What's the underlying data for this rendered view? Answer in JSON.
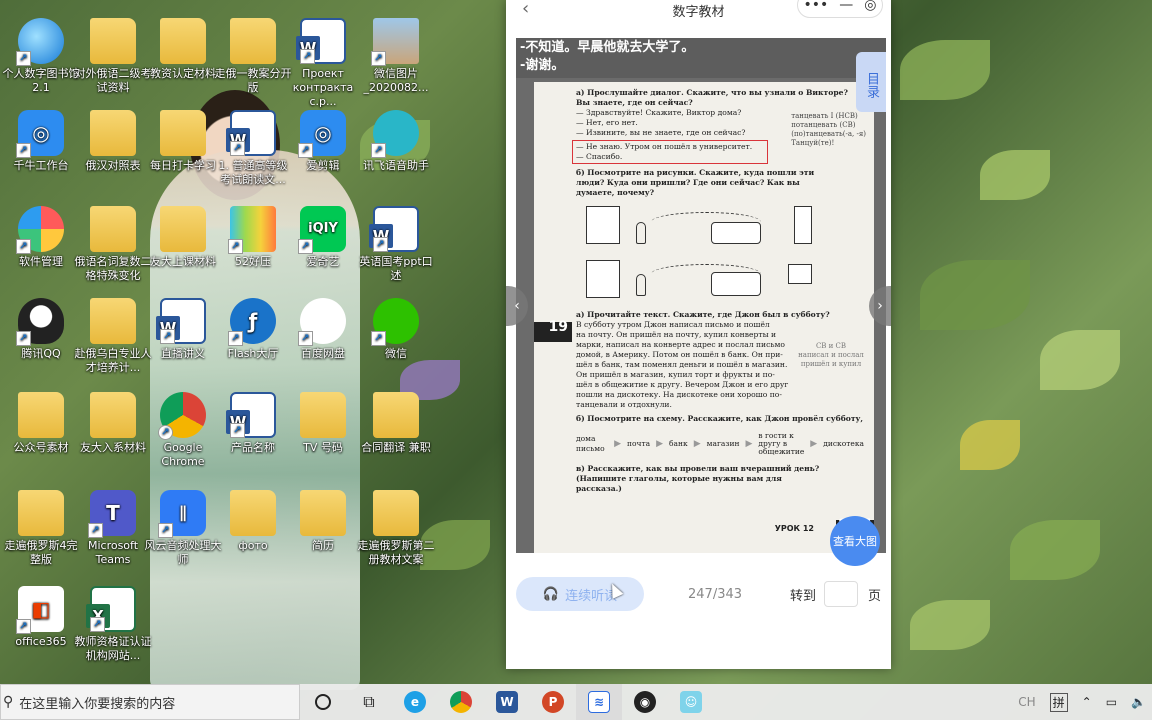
{
  "desktop": {
    "icons": [
      {
        "label": "个人数字图书馆2.1",
        "kind": "globe"
      },
      {
        "label": "对外俄语二级考试资料",
        "kind": "folder"
      },
      {
        "label": "教资认定材料",
        "kind": "folder"
      },
      {
        "label": "走俄一教案分开版",
        "kind": "folder"
      },
      {
        "label": "Проект контракта с.р...",
        "kind": "word"
      },
      {
        "label": "微信图片_2020082...",
        "kind": "photo"
      },
      {
        "label": "千牛工作台",
        "kind": "blue"
      },
      {
        "label": "俄汉对照表",
        "kind": "folder"
      },
      {
        "label": "每日打卡学习",
        "kind": "folder"
      },
      {
        "label": "1. 普通高等级考试朗读文...",
        "kind": "word"
      },
      {
        "label": "爱剪辑",
        "kind": "blue"
      },
      {
        "label": "讯飞语音助手",
        "kind": "teal"
      },
      {
        "label": "软件管理",
        "kind": "petal"
      },
      {
        "label": "俄语名词复数二格特殊变化",
        "kind": "folder"
      },
      {
        "label": "友大上课材料",
        "kind": "folder"
      },
      {
        "label": "52好压",
        "kind": "zip"
      },
      {
        "label": "爱奇艺",
        "kind": "iqiyi"
      },
      {
        "label": "英语国考ppt口述",
        "kind": "word"
      },
      {
        "label": "腾讯QQ",
        "kind": "qq"
      },
      {
        "label": "赴俄乌白专业人才培养计...",
        "kind": "folder"
      },
      {
        "label": "直播讲义",
        "kind": "word"
      },
      {
        "label": "Flash大厅",
        "kind": "flash"
      },
      {
        "label": "百度网盘",
        "kind": "cloud"
      },
      {
        "label": "微信",
        "kind": "wechat"
      },
      {
        "label": "公众号素材",
        "kind": "folder"
      },
      {
        "label": "友大入系材料",
        "kind": "folder"
      },
      {
        "label": "Google Chrome",
        "kind": "chrome"
      },
      {
        "label": "产品名称",
        "kind": "word"
      },
      {
        "label": "TV 号码",
        "kind": "folder"
      },
      {
        "label": "合同翻译 兼职",
        "kind": "folder"
      },
      {
        "label": "走遍俄罗斯4完整版",
        "kind": "folder"
      },
      {
        "label": "Microsoft Teams",
        "kind": "teams"
      },
      {
        "label": "风云音频处理大师",
        "kind": "audio"
      },
      {
        "label": "фото",
        "kind": "folder"
      },
      {
        "label": "简历",
        "kind": "folder"
      },
      {
        "label": "走遍俄罗斯第二册教材文案",
        "kind": "folder"
      },
      {
        "label": "office365",
        "kind": "office"
      },
      {
        "label": "教师资格证认证机构网站...",
        "kind": "excel"
      }
    ]
  },
  "app": {
    "title": "数字教材",
    "back_glyph": "‹",
    "menu_glyph": "•••",
    "minimize_glyph": "—",
    "close_glyph": "◎",
    "subtitle_line1": "-不知道。早晨他就去大学了。",
    "subtitle_line2": "-谢谢。",
    "toc_label": "目录",
    "view_large_label": "查看大图",
    "listen_label": "连续听读",
    "page_indicator": "247/343",
    "goto_label": "转到",
    "page_suffix": "页",
    "page": {
      "lines_top": [
        "а) Прослушайте диалог. Скажите, что вы узнали о Викторе?",
        "    Вы знаете, где он сейчас?",
        "— Здравствуйте! Скажите, Виктор дома?",
        "— Нет, его нет.",
        "— Извините, вы не знаете, где он сейчас?"
      ],
      "highlight_lines": [
        "— Не знаю. Утром он пошёл в университет.",
        "— Спасибо."
      ],
      "side_notes": [
        "танцевать I (НСВ)",
        "потанцевать (СВ)",
        "",
        "(по)танцевать(-а, -я)",
        "Танцуй(те)!"
      ],
      "task_b": "б) Посмотрите на рисунки. Скажите, куда пошли эти люди? Куда они пришли? Где они сейчас? Как вы думаете, почему?",
      "lesson_marker": "19",
      "task_a2": "а) Прочитайте текст. Скажите, где Джон был в субботу?",
      "text_lines": [
        "В субботу утром Джон написал письмо и пошёл",
        "на почту. Он пришёл на почту, купил конверты и",
        "марки, написал на конверте адрес и послал письмо",
        "домой, в Америку. Потом он пошёл в банк. Он при-",
        "шёл в банк, там поменял деньги и пошёл в магазин.",
        "Он пришёл в магазин, купил торт и фрукты и по-",
        "шёл в общежитие к другу. Вечером Джон и его друг",
        "пошли на дискотеку. На дискотеке они хорошо по-",
        "танцевали и отдохнули."
      ],
      "side_notes2": [
        "СВ    и    СВ",
        "написал и послал",
        "пришёл и купил"
      ],
      "task_b2": "б) Посмотрите на схему. Расскажите, как Джон провёл субботу, что он делал?",
      "schema": [
        "дома письмо",
        "почта",
        "банк",
        "магазин",
        "в гости к другу в общежитие",
        "дискотека"
      ],
      "task_v": "в) Расскажите, как вы провели ваш вчерашний день? (Напишите глаголы, которые нужны вам для рассказа.)",
      "footer_lesson": "УРОК 12",
      "footer_page": "247"
    }
  },
  "taskbar": {
    "search_placeholder": "在这里输入你要搜索的内容",
    "ime_label": "拼",
    "tray_ch": "CH"
  }
}
